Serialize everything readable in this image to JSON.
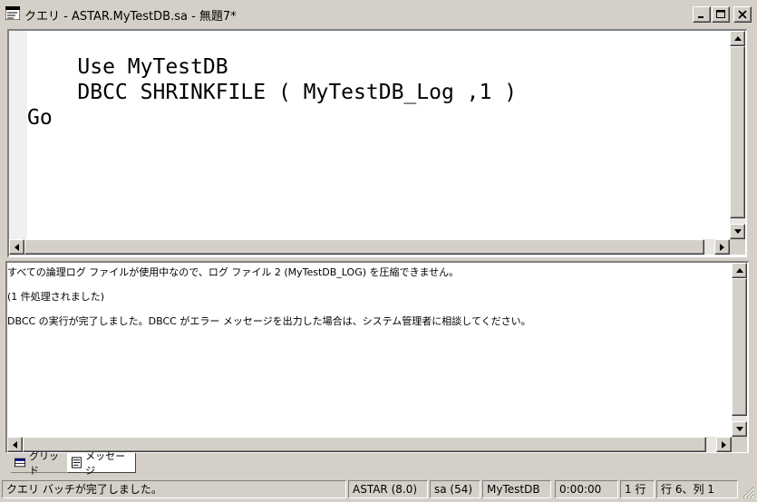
{
  "window": {
    "title": "クエリ - ASTAR.MyTestDB.sa - 無題7*"
  },
  "editor": {
    "lines": [
      "    Use MyTestDB",
      "    DBCC SHRINKFILE ( MyTestDB_Log ,1 )",
      "Go"
    ]
  },
  "results": {
    "messages": [
      "すべての論理ログ ファイルが使用中なので、ログ ファイル 2 (MyTestDB_LOG) を圧縮できません。",
      "(1 件処理されました)",
      "DBCC の実行が完了しました。DBCC がエラー メッセージを出力した場合は、システム管理者に相談してください。"
    ]
  },
  "tabs": [
    {
      "label": "グリッド",
      "icon": "grid-icon",
      "active": false
    },
    {
      "label": "メッセージ",
      "icon": "message-icon",
      "active": true
    }
  ],
  "statusbar": {
    "message": "クエリ バッチが完了しました。",
    "server": "ASTAR (8.0)",
    "user": "sa (54)",
    "database": "MyTestDB",
    "elapsed": "0:00:00",
    "rows": "1 行",
    "position": "行 6、列 1"
  }
}
